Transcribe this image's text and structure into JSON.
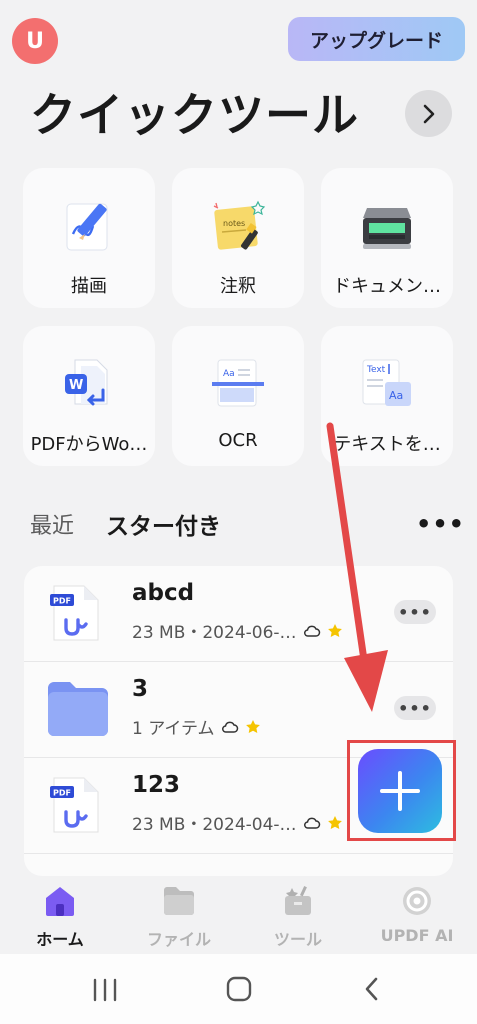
{
  "header": {
    "avatar_letter": "U",
    "upgrade_label": "アップグレード",
    "title": "クイックツール"
  },
  "tools": [
    {
      "label": "描画",
      "icon": "pen-draw-icon"
    },
    {
      "label": "注釈",
      "icon": "sticky-note-icon"
    },
    {
      "label": "ドキュメン…",
      "icon": "scanner-icon"
    },
    {
      "label": "PDFからWo…",
      "icon": "pdf-to-word-icon"
    },
    {
      "label": "OCR",
      "icon": "ocr-icon"
    },
    {
      "label": "テキストを…",
      "icon": "text-convert-icon"
    }
  ],
  "tabs": {
    "recent": "最近",
    "starred": "スター付き"
  },
  "files": [
    {
      "name": "abcd",
      "meta": "23 MB・2024-06-…",
      "type": "pdf"
    },
    {
      "name": "3",
      "meta": "1 アイテム",
      "type": "folder"
    },
    {
      "name": "123",
      "meta": "23 MB・2024-04-…",
      "type": "pdf"
    }
  ],
  "nav": {
    "home": "ホーム",
    "files": "ファイル",
    "tools": "ツール",
    "ai": "UPDF AI"
  },
  "colors": {
    "accent": "#6a4dff",
    "avatar": "#f36f6f",
    "annotation_red": "#e34848",
    "star": "#f5c400"
  }
}
